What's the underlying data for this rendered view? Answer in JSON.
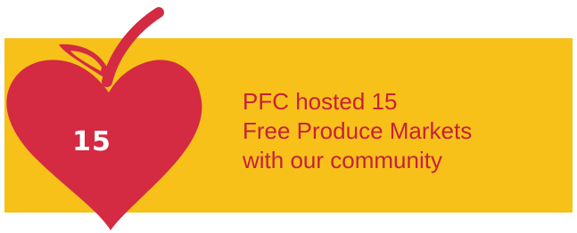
{
  "badge": {
    "count": "15"
  },
  "message": {
    "lines": [
      "PFC hosted 15",
      "Free Produce Markets",
      "with our community"
    ]
  },
  "colors": {
    "banner": "#F7C11A",
    "apple": "#D42A42",
    "text": "#C8203A",
    "badge_text": "#FFFFFF"
  },
  "icons": {
    "apple": "apple-heart-icon"
  }
}
